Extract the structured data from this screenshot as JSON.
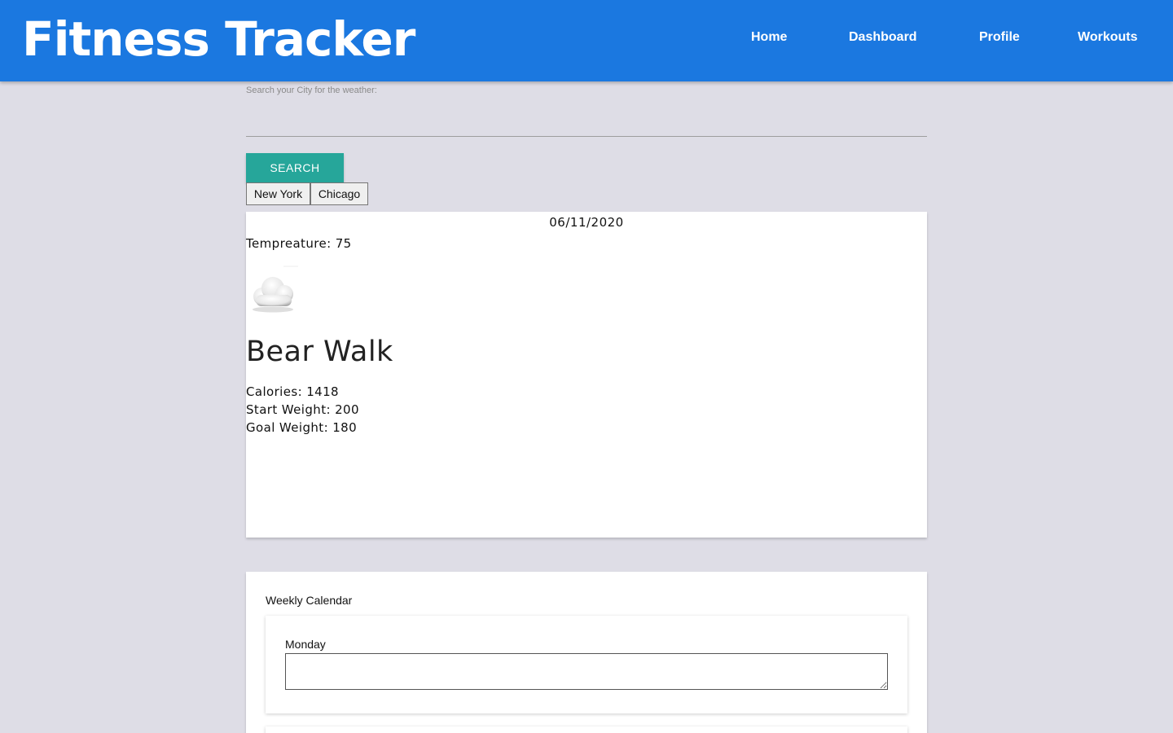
{
  "header": {
    "brand": "Fitness Tracker",
    "nav": [
      "Home",
      "Dashboard",
      "Profile",
      "Workouts"
    ]
  },
  "search": {
    "label": "Search your City for the weather:",
    "value": "",
    "button_label": "SEARCH",
    "cities": [
      "New York",
      "Chicago"
    ]
  },
  "weather": {
    "date": "06/11/2020",
    "temperature": "Tempreature: 75",
    "icon": "cloud-icon",
    "workout_title": "Bear Walk",
    "calories": "Calories: 1418",
    "start_weight": "Start Weight: 200",
    "goal_weight": "Goal Weight: 180"
  },
  "calendar": {
    "title": "Weekly Calendar",
    "days": [
      "Monday"
    ],
    "monday_value": ""
  },
  "colors": {
    "header_blue": "#1b78e0",
    "search_button": "#26a69a",
    "page_background": "#dedde6"
  }
}
